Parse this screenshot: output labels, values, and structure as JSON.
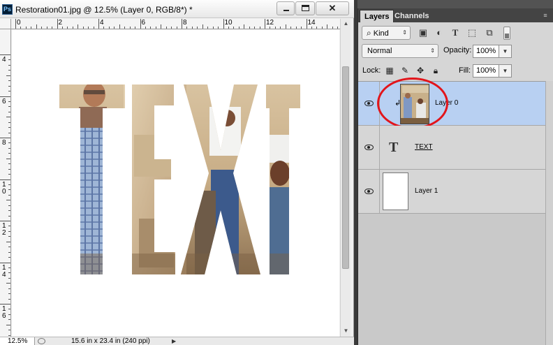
{
  "document": {
    "title": "Restoration01.jpg @ 12.5% (Layer 0, RGB/8*) *",
    "app_icon": "Ps",
    "window_buttons": {
      "minimize": "minimize-icon",
      "maximize": "maximize-icon",
      "close": "✕"
    },
    "ruler_h_labels": [
      "0",
      "2",
      "4",
      "6",
      "8",
      "10",
      "12",
      "14"
    ],
    "ruler_v_labels": [
      "4",
      "6",
      "8",
      "10",
      "12",
      "14",
      "16"
    ],
    "canvas_text": "TEXT",
    "status": {
      "zoom": "12.5%",
      "doc_size": "15.6 in x 23.4 in (240 ppi)"
    }
  },
  "layers_panel": {
    "tabs": [
      "Layers",
      "Channels"
    ],
    "active_tab": "Layers",
    "filter": {
      "kind_label": "Kind",
      "icons": [
        "image-filter-icon",
        "adjustment-filter-icon",
        "type-filter-icon",
        "shape-filter-icon",
        "smart-object-filter-icon"
      ]
    },
    "blend_mode": "Normal",
    "opacity_label": "Opacity:",
    "opacity_value": "100%",
    "lock_label": "Lock:",
    "lock_icons": [
      "lock-transparent-icon",
      "lock-image-icon",
      "lock-position-icon",
      "lock-all-icon"
    ],
    "fill_label": "Fill:",
    "fill_value": "100%",
    "layers": [
      {
        "name": "Layer 0",
        "selected": true,
        "clipped": true,
        "thumb": "photo"
      },
      {
        "name": "TEXT",
        "selected": false,
        "type": "text"
      },
      {
        "name": "Layer 1",
        "selected": false,
        "thumb": "white"
      }
    ]
  },
  "colors": {
    "selection": "#b8d0f2",
    "highlight_ring": "#e2151b",
    "panel_bg": "#d6d6d6"
  }
}
